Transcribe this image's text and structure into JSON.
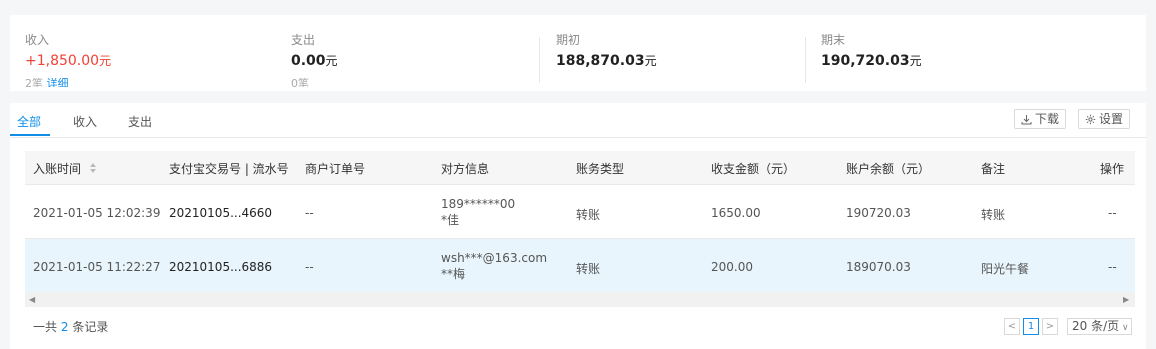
{
  "summary": {
    "income": {
      "label": "收入",
      "value": "+1,850.00",
      "unit": "元",
      "count": "2笔",
      "link": "详细"
    },
    "expense": {
      "label": "支出",
      "value": "0.00",
      "unit": "元",
      "count": "0笔"
    },
    "opening": {
      "label": "期初",
      "value": "188,870.03",
      "unit": "元"
    },
    "closing": {
      "label": "期末",
      "value": "190,720.03",
      "unit": "元"
    }
  },
  "tabs": [
    {
      "label": "全部",
      "active": true
    },
    {
      "label": "收入",
      "active": false
    },
    {
      "label": "支出",
      "active": false
    }
  ],
  "toolbar": {
    "download_label": "下载",
    "settings_label": "设置"
  },
  "table": {
    "columns": [
      "入账时间",
      "支付宝交易号 | 流水号",
      "商户订单号",
      "对方信息",
      "账务类型",
      "收支金额（元）",
      "账户余额（元）",
      "备注",
      "操作"
    ],
    "rows": [
      {
        "time": "2021-01-05 12:02:39",
        "trade_no": "20210105...4660",
        "order_no": "--",
        "party_line1": "189******00",
        "party_line2": "*佳",
        "type": "转账",
        "amount": "1650.00",
        "balance": "190720.03",
        "note": "转账",
        "action": "--",
        "highlight": false
      },
      {
        "time": "2021-01-05 11:22:27",
        "trade_no": "20210105...6886",
        "order_no": "--",
        "party_line1": "wsh***@163.com",
        "party_line2": "**梅",
        "type": "转账",
        "amount": "200.00",
        "balance": "189070.03",
        "note": "阳光午餐",
        "action": "--",
        "highlight": true
      }
    ]
  },
  "footer": {
    "total_prefix": "一共",
    "total_count": "2",
    "total_suffix": "条记录",
    "current_page": "1",
    "page_size": "20 条/页"
  },
  "colors": {
    "accent": "#108ee9",
    "positive": "#f04134",
    "row_highlight": "#e8f5fc"
  }
}
